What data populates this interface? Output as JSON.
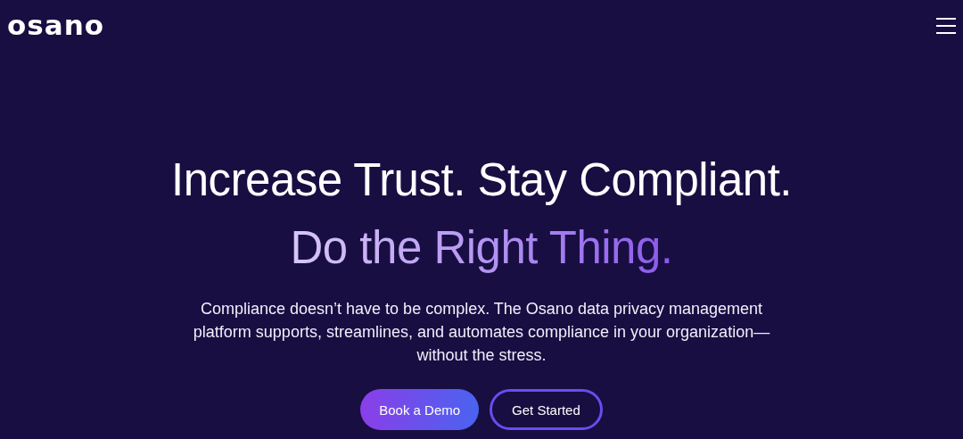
{
  "header": {
    "logo": "osano"
  },
  "hero": {
    "title": "Increase Trust. Stay Compliant.",
    "subtitle": "Do the Right Thing.",
    "description": "Compliance doesn’t have to be complex. The Osano data privacy management platform supports, streamlines, and automates compliance in your organization—without the stress.",
    "buttons": [
      {
        "label": "Book a Demo",
        "kind": "primary"
      },
      {
        "label": "Get Started",
        "kind": "outline"
      }
    ]
  }
}
